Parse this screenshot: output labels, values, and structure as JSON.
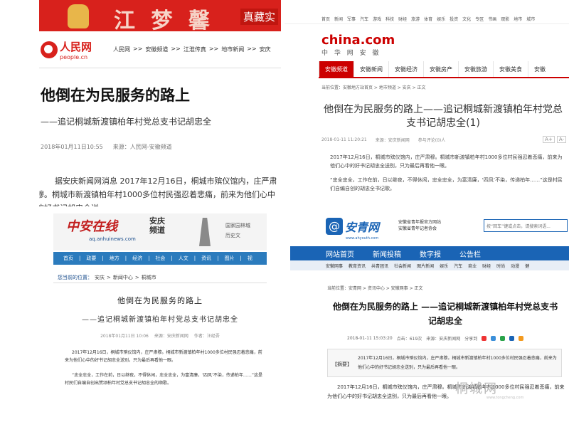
{
  "p1": {
    "banner_text": "江 梦 馨",
    "banner_tag": "真藏实",
    "logo_cn": "人民网",
    "logo_en": "people.cn",
    "crumbs": [
      "人民网",
      ">>",
      "安徽频道",
      ">>",
      "江淮传真",
      ">>",
      "地市新闻",
      ">>",
      "安庆"
    ],
    "title": "他倒在为民服务的路上",
    "subtitle": "——追记桐城新渡镇柏年村党总支书记胡忠全",
    "date": "2018年01月11日10:55",
    "source": "来源：人民网-安徽频道",
    "body": "据安庆新闻网消息 2017年12月16日，桐城市殡仪馆内，庄严肃穆。桐城市新渡镇柏年村1000多位村民强忍着悲痛，前来为他们心中的好书记胡忠全送"
  },
  "p2": {
    "topnav": [
      "首页",
      "新闻",
      "军事",
      "汽车",
      "游戏",
      "科技",
      "财经",
      "旅游",
      "体育",
      "娱乐",
      "投资",
      "文化",
      "专区",
      "书画",
      "观影",
      "地市",
      "城市"
    ],
    "logo": "china.com",
    "logo_sub": "中 华 网 安 徽",
    "tabs": [
      "安徽频道",
      "安徽新闻",
      "安徽经济",
      "安徽房产",
      "安徽旅游",
      "安徽美食",
      "安徽"
    ],
    "crumbs": "当前位置：安徽地方站首页 > 地市频道 > 安庆 > 正文",
    "title": "他倒在为民服务的路上——追记桐城新渡镇柏年村党总支书记胡忠全(1)",
    "date": "2018-01-11 11:20:21",
    "source": "来源：安庆新闻网",
    "comments": "参与评论(0)人",
    "font_a": "A+",
    "font_b": "A-",
    "body1": "2017年12月16日，桐城市殡仪馆内，庄严肃穆。桐城市新渡镇柏年村1000多位村民强忍着悲痛，前来为他们心中的好书记胡忠全送别，只为最后再看他一眼。",
    "body2": "“忠全忠全，工作在前，日以继夜，不得休闲，忠全忠全，为富清廉，‘四风’不染，传递柏年……”这是村民们自编自创的胡忠全书记歌。"
  },
  "p3": {
    "logo": "中安在线",
    "logo_city": "安庆",
    "logo_ch": "频道",
    "url": "aq.anhuinews.com",
    "right1": "国家园林城",
    "right2": "历史文",
    "nav": [
      "首页",
      "政要",
      "地方",
      "经济",
      "社会",
      "人文",
      "资讯",
      "图片",
      "视"
    ],
    "crumbs": [
      "您当前的位置：",
      "安庆",
      ">",
      "新闻中心",
      ">",
      "桐城市"
    ],
    "title": "他倒在为民服务的路上",
    "subtitle": "——追记桐城新渡镇柏年村党总支书记胡忠全",
    "date": "2018年01月11日 10:06",
    "source": "来源：安庆新闻网",
    "author": "作者：汪经吾",
    "body1": "2017年12月16日，桐城市殡仪馆内，庄严肃穆。桐城市新渡镇柏年村1000多位村民强忍着悲痛，前来为他们心中的好书记胡忠全送别，只为最后再看他一眼。",
    "body2": "“忠全忠全，工作在前，日以继夜，不得休闲，忠全忠全，为富清廉，‘四风’不染，传递柏年……”这是村民们自编自创出赞颂柏年村党总支书记胡忠全的顺歌。"
  },
  "p4": {
    "logo": "安青网",
    "logo_sub": "www.ahyouth.com",
    "tag1": "安徽省青年报官方网站",
    "tag2": "安徽省青年记者协会",
    "search_placeholder": "按“回车”键或点击，请搜索词语...",
    "nav1": [
      "网站首页",
      "新闻投稿",
      "数字报",
      "公告栏"
    ],
    "nav2": [
      "安徽网事",
      "教育资讯",
      "共青团讯",
      "社会新闻",
      "图片新闻",
      "娱乐",
      "汽车",
      "商业",
      "财经",
      "时尚",
      "动漫",
      "健"
    ],
    "crumbs": "当前位置：安青网 > 资讯中心 > 安徽网事 > 正文",
    "title": "他倒在为民服务的路上 ——追记桐城新渡镇柏年村党总支书记胡忠全",
    "date": "2018-01-11 15:03:20",
    "clicks": "点击：619次",
    "source": "来源：安庆新闻网",
    "share": "分享到",
    "abs_label": "【摘要】",
    "abs_text": "2017年12月16日，桐城市殡仪馆内，庄严肃穆。桐城市新渡镇柏年村1000多位村民强忍着悲痛，前来为他们心中的好书记胡忠全送别，只为最后再看他一眼。",
    "body": "2017年12月16日，桐城市殡仪馆内，庄严肃穆。桐城市新渡镇柏年村1000多位村民强忍着悲痛，前来为他们心中的好书记胡忠全送别，只为最后再看他一眼。",
    "watermark": "桐城网",
    "watermark_url": "www.tongcheng.com",
    "colors": {
      "brand": "#1a64b5"
    }
  }
}
